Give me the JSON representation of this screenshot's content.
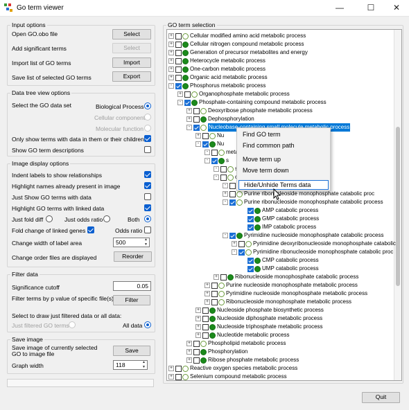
{
  "window": {
    "title": "Go term viewer",
    "minimize": "—",
    "maximize": "☐",
    "close": "✕"
  },
  "input_options": {
    "legend": "Input options",
    "rows": [
      {
        "label": "Open GO.obo file",
        "button": "Select"
      },
      {
        "label": "Add significant terms",
        "button": "Select"
      },
      {
        "label": "Import list of GO terms",
        "button": "Import"
      },
      {
        "label": "Save list of selected GO terms",
        "button": "Export"
      }
    ]
  },
  "data_tree": {
    "legend": "Data tree view options",
    "select_label": "Select the GO data set",
    "datasets": [
      "Biological Process",
      "Cellular component",
      "Molecular function"
    ],
    "only_show": "Only show terms with data in them or their children",
    "show_desc": "Show GO term descriptions"
  },
  "image_display": {
    "legend": "Image display options",
    "opts": [
      "Indent labels to show relationships",
      "Highlight names already present in image",
      "Just Show GO terms with data",
      "Highlight GO terms with linked data"
    ],
    "just_fold": "Just fold diff",
    "just_odds": "Just odds ratio",
    "both": "Both",
    "fold_change": "Fold change of linked genes",
    "odds_ratio": "Odds ratio",
    "width_label": "Change width of label area",
    "width_value": "500",
    "order_label": "Change order files are displayed",
    "reorder": "Reorder"
  },
  "filter": {
    "legend": "Filter data",
    "cutoff_label": "Significance cutoff",
    "cutoff_value": "0.05",
    "filter_terms_label": "Filter terms by p value of specific file(s)",
    "filter_button": "Filter",
    "draw_label": "Select to draw just filtered data or all data:",
    "just_filtered": "Just filtered GO terms",
    "all_data": "All data"
  },
  "save_image": {
    "legend": "Save image",
    "save_label": "Save image of currently selected GO to image file",
    "save_button": "Save",
    "graph_width_label": "Graph width",
    "graph_width_value": "118"
  },
  "tree": {
    "legend": "GO term selection",
    "nodes": [
      {
        "label": "Cellular modified amino acid metabolic process"
      },
      {
        "label": "Cellular nitrogen compound metabolic process"
      },
      {
        "label": "Generation of precursor metabolites and energy"
      },
      {
        "label": "Heterocycle metabolic process"
      },
      {
        "label": "One-carbon metabolic process"
      },
      {
        "label": "Organic acid metabolic process"
      },
      {
        "label": "Phosphorus metabolic process"
      },
      {
        "label": "Organophosphate metabolic process"
      },
      {
        "label": "Phosphate-containing compound metabolic process"
      },
      {
        "label": "Deoxyribose phosphate metabolic process"
      },
      {
        "label": "Dephosphorylation"
      },
      {
        "label": "Nucleobase-containing small molecule metabolic process"
      },
      {
        "label": "Nu"
      },
      {
        "label": "Nu"
      },
      {
        "label": "metabolic process"
      },
      {
        "label": "s"
      },
      {
        "label": "s"
      },
      {
        "label": "catabolic process"
      },
      {
        "label": "tabolic process"
      },
      {
        "label": "Purine ribonucleoside monophosphate catabolic proc"
      },
      {
        "label": "Purine ribonucleoside monophosphate catabolic process"
      },
      {
        "label": "AMP catabolic process"
      },
      {
        "label": "GMP catabolic process"
      },
      {
        "label": "IMP catabolic process"
      },
      {
        "label": "Pyrimidine nucleoside monophosphate catabolic process"
      },
      {
        "label": "Pyrimidine deoxyribonucleoside monophosphate catabolic"
      },
      {
        "label": "Pyrimidine ribonucleoside monophosphate catabolic proc"
      },
      {
        "label": "CMP catabolic process"
      },
      {
        "label": "UMP catabolic process"
      },
      {
        "label": "Ribonucleoside monophosphate catabolic process"
      },
      {
        "label": "Purine nucleoside monophosphate metabolic process"
      },
      {
        "label": "Pyrimidine nucleoside monophosphate metabolic process"
      },
      {
        "label": "Ribonucleoside monophosphate metabolic process"
      },
      {
        "label": "Nucleoside phosphate biosynthetic process"
      },
      {
        "label": "Nucleoside diphosphate metabolic process"
      },
      {
        "label": "Nucleoside triphosphate metabolic process"
      },
      {
        "label": "Nucleotide metabolic process"
      },
      {
        "label": "Phospholipid metabolic process"
      },
      {
        "label": "Phosphorylation"
      },
      {
        "label": "Ribose phosphate metabolic process"
      },
      {
        "label": "Reactive oxygen species metabolic process"
      },
      {
        "label": "Selenium compound metabolic process"
      }
    ]
  },
  "context_menu": {
    "items": [
      "Find GO term",
      "Find common path",
      "Move term up",
      "Move term down",
      "Hide/Unhide Terms data"
    ]
  },
  "quit": "Quit",
  "colors": {
    "accent": "#0a5fd0",
    "selection": "#0078d7",
    "data_dot": "#1c8a1c"
  }
}
